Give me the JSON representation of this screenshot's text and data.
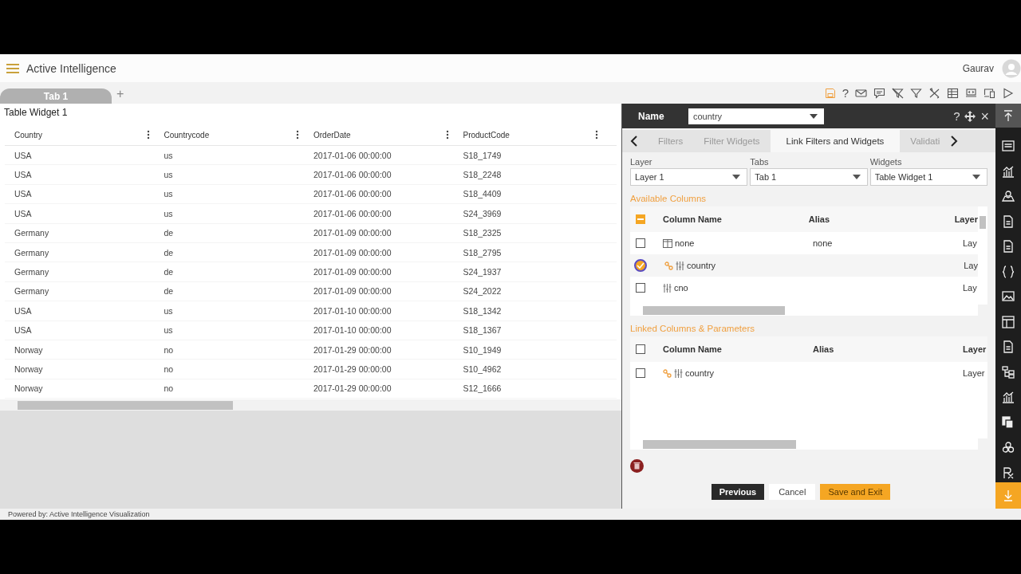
{
  "app": {
    "title": "Active Intelligence",
    "user": "Gaurav"
  },
  "tabs": [
    {
      "label": "Tab 1",
      "selected": true
    }
  ],
  "add_tab": "+",
  "toolbar_help": "?",
  "widget": {
    "title": "Table Widget 1",
    "columns": [
      "Country",
      "Countrycode",
      "OrderDate",
      "ProductCode"
    ],
    "rows": [
      [
        "USA",
        "us",
        "2017-01-06 00:00:00",
        "S18_1749"
      ],
      [
        "USA",
        "us",
        "2017-01-06 00:00:00",
        "S18_2248"
      ],
      [
        "USA",
        "us",
        "2017-01-06 00:00:00",
        "S18_4409"
      ],
      [
        "USA",
        "us",
        "2017-01-06 00:00:00",
        "S24_3969"
      ],
      [
        "Germany",
        "de",
        "2017-01-09 00:00:00",
        "S18_2325"
      ],
      [
        "Germany",
        "de",
        "2017-01-09 00:00:00",
        "S18_2795"
      ],
      [
        "Germany",
        "de",
        "2017-01-09 00:00:00",
        "S24_1937"
      ],
      [
        "Germany",
        "de",
        "2017-01-09 00:00:00",
        "S24_2022"
      ],
      [
        "USA",
        "us",
        "2017-01-10 00:00:00",
        "S18_1342"
      ],
      [
        "USA",
        "us",
        "2017-01-10 00:00:00",
        "S18_1367"
      ],
      [
        "Norway",
        "no",
        "2017-01-29 00:00:00",
        "S10_1949"
      ],
      [
        "Norway",
        "no",
        "2017-01-29 00:00:00",
        "S10_4962"
      ],
      [
        "Norway",
        "no",
        "2017-01-29 00:00:00",
        "S12_1666"
      ]
    ]
  },
  "footer": "Powered by: Active Intelligence Visualization",
  "panel": {
    "name_label": "Name",
    "name_value": "country",
    "help": "?",
    "close": "×",
    "tabs": [
      {
        "label": "Filters",
        "selected": false
      },
      {
        "label": "Filter Widgets",
        "selected": false
      },
      {
        "label": "Link Filters and Widgets",
        "selected": true
      },
      {
        "label": "Validati",
        "selected": false
      }
    ],
    "fields": [
      {
        "label": "Layer",
        "value": "Layer 1"
      },
      {
        "label": "Tabs",
        "value": "Tab 1"
      },
      {
        "label": "Widgets",
        "value": "Table Widget 1"
      }
    ],
    "available": {
      "title": "Available Columns",
      "header_indeterminate": true,
      "columns": [
        "Column Name",
        "Alias",
        "Layer"
      ],
      "rows": [
        {
          "kind": "table",
          "linked": false,
          "checked": false,
          "name": "none",
          "alias": "none",
          "layer": "Lay"
        },
        {
          "kind": "column",
          "linked": true,
          "checked": true,
          "name": "country",
          "layer": "Lay"
        },
        {
          "kind": "column",
          "linked": false,
          "checked": false,
          "name": "cno",
          "layer": "Lay"
        }
      ]
    },
    "linked": {
      "title": "Linked Columns & Parameters",
      "header_indeterminate": false,
      "columns": [
        "Column Name",
        "Alias",
        "Layer"
      ],
      "rows": [
        {
          "kind": "column",
          "linked": true,
          "checked": false,
          "name": "country",
          "layer": "Layer"
        }
      ]
    },
    "buttons": [
      {
        "label": "Previous",
        "kind": "dark"
      },
      {
        "label": "Cancel",
        "kind": "plain"
      },
      {
        "label": "Save and Exit",
        "kind": "primary"
      }
    ]
  }
}
